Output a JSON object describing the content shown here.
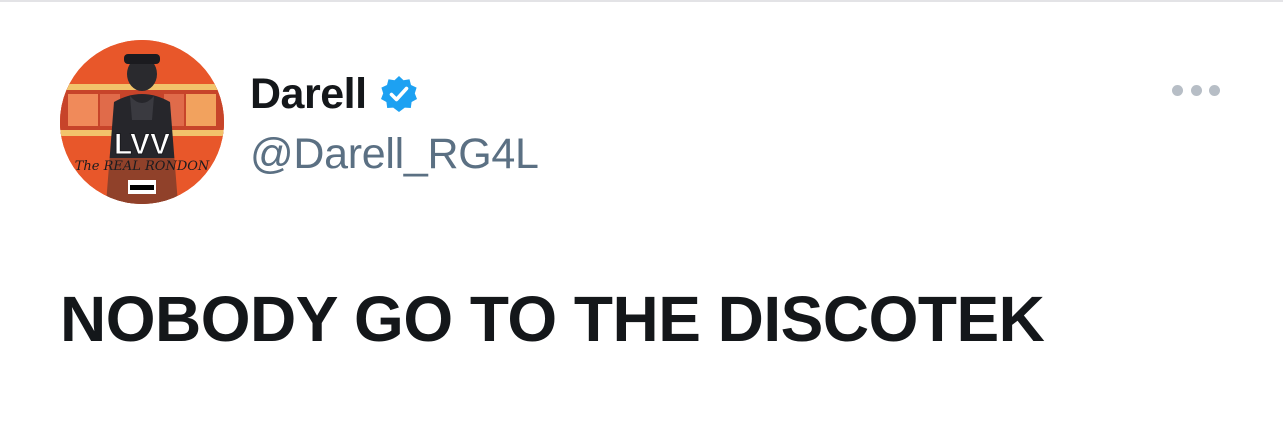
{
  "tweet": {
    "author": {
      "display_name": "Darell",
      "handle": "@Darell_RG4L",
      "verified": true,
      "verified_icon": "verified-badge-icon",
      "avatar": {
        "description_icon": "profile-avatar",
        "art_text_main": "LVV",
        "art_text_script": "The REAL RONDON",
        "art_badge": "PARENTAL ADVISORY"
      }
    },
    "more_icon": "more-horizontal-icon",
    "text": "NOBODY GO TO THE DISCOTEK"
  },
  "colors": {
    "text_primary": "#14171a",
    "text_secondary": "#5b7083",
    "verified_blue": "#1da1f2",
    "more_dots": "#b7bec6",
    "avatar_bg": "#e8572a"
  }
}
